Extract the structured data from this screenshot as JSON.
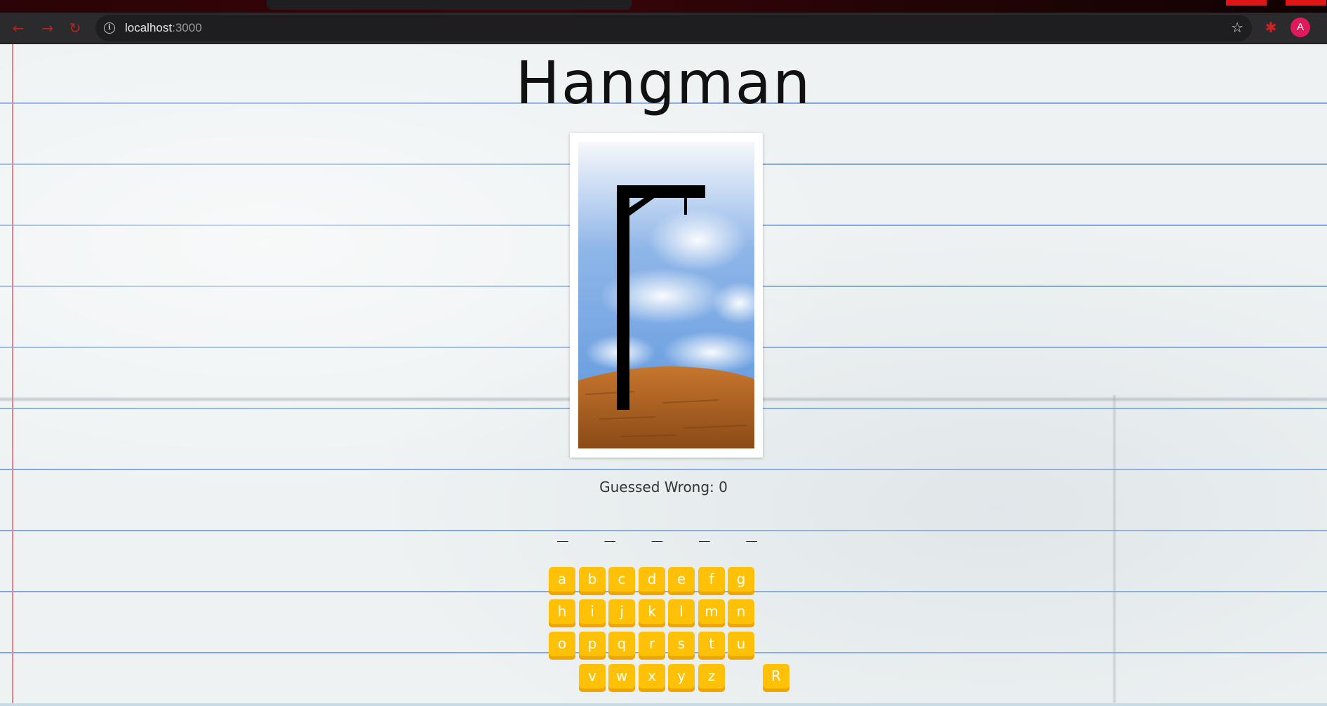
{
  "browser": {
    "url_host": "localhost",
    "url_port": ":3000",
    "avatar_letter": "A",
    "icons": {
      "back": "arrow-left-icon",
      "forward": "arrow-right-icon",
      "reload": "reload-icon",
      "info": "info-icon",
      "bookmark": "star-icon",
      "extension": "puzzle-icon"
    }
  },
  "game": {
    "title": "Hangman",
    "wrong_label": "Guessed Wrong: 0",
    "word_blanks": "_ _ _ _ _",
    "keys": [
      "a",
      "b",
      "c",
      "d",
      "e",
      "f",
      "g",
      "h",
      "i",
      "j",
      "k",
      "l",
      "m",
      "n",
      "o",
      "p",
      "q",
      "r",
      "s",
      "t",
      "u",
      "v",
      "w",
      "x",
      "y",
      "z"
    ],
    "reset_label": "R"
  },
  "colors": {
    "key_fill": "#ffc107",
    "key_shadow": "#f0a500",
    "ruled_line": "#7ea6dd",
    "margin_line": "#e7828d",
    "avatar": "#e0195a"
  }
}
